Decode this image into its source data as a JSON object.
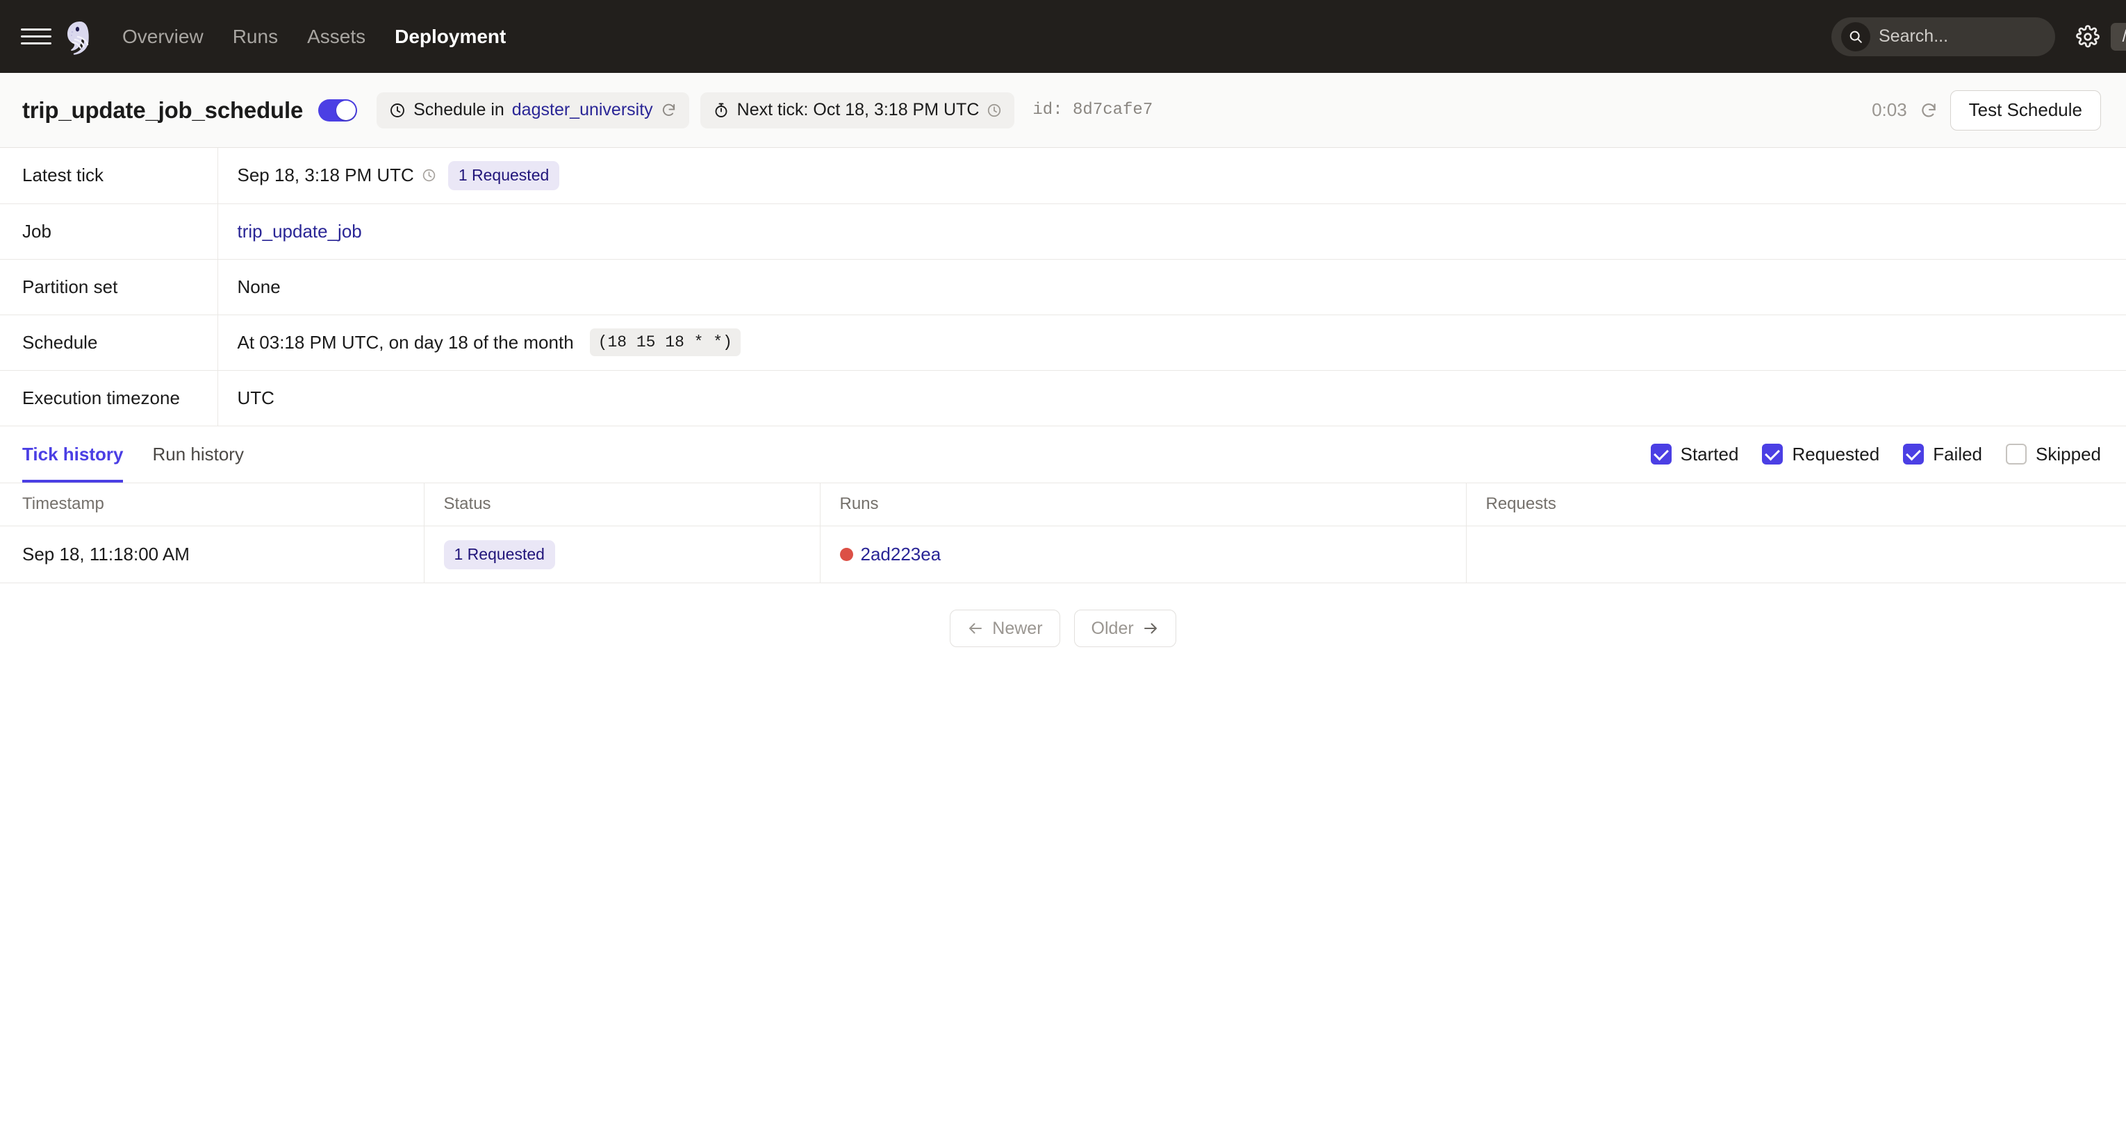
{
  "topnav": {
    "menu_icon": "hamburger-menu-icon",
    "logo_icon": "dagster-logo-icon",
    "links": [
      {
        "label": "Overview",
        "active": false
      },
      {
        "label": "Runs",
        "active": false
      },
      {
        "label": "Assets",
        "active": false
      },
      {
        "label": "Deployment",
        "active": true
      }
    ],
    "search": {
      "placeholder": "Search...",
      "value": "",
      "icon": "search-icon",
      "shortcut": "/"
    },
    "settings_icon": "gear-icon",
    "background_color": "#221F1C"
  },
  "header": {
    "title": "trip_update_job_schedule",
    "toggle_on": true,
    "schedule_chip": {
      "icon": "clock-icon",
      "prefix": "Schedule in",
      "location": "dagster_university",
      "refresh_icon": "refresh-icon"
    },
    "next_tick_chip": {
      "icon": "timer-icon",
      "label": "Next tick: Oct 18, 3:18 PM UTC",
      "timezone_icon": "clock-icon"
    },
    "id_label": "id:",
    "id_value": "8d7cafe7",
    "countdown": "0:03",
    "refresh_icon": "refresh-icon",
    "test_button": "Test Schedule",
    "accent_color": "#4B3FE4",
    "link_color": "#2A2696"
  },
  "details": {
    "rows": [
      {
        "label": "Latest tick",
        "value": "Sep 18, 3:18 PM UTC",
        "has_tz_icon": true,
        "badge": "1 Requested",
        "type": "tick"
      },
      {
        "label": "Job",
        "value": "trip_update_job",
        "type": "link"
      },
      {
        "label": "Partition set",
        "value": "None",
        "type": "text"
      },
      {
        "label": "Schedule",
        "value": "At 03:18 PM UTC, on day 18 of the month",
        "cron": "(18 15 18 * *)",
        "type": "cron"
      },
      {
        "label": "Execution timezone",
        "value": "UTC",
        "type": "text"
      }
    ]
  },
  "tabs": [
    {
      "label": "Tick history",
      "active": true
    },
    {
      "label": "Run history",
      "active": false
    }
  ],
  "filters": [
    {
      "label": "Started",
      "checked": true
    },
    {
      "label": "Requested",
      "checked": true
    },
    {
      "label": "Failed",
      "checked": true
    },
    {
      "label": "Skipped",
      "checked": false
    }
  ],
  "history": {
    "columns": [
      "Timestamp",
      "Status",
      "Runs",
      "Requests"
    ],
    "rows": [
      {
        "timestamp": "Sep 18, 11:18:00 AM",
        "status": "1 Requested",
        "run_id": "2ad223ea",
        "run_dot_color": "#DC5046",
        "requests": ""
      }
    ]
  },
  "pagination": {
    "newer": "Newer",
    "older": "Older",
    "newer_icon": "arrow-left-icon",
    "older_icon": "arrow-right-icon"
  }
}
